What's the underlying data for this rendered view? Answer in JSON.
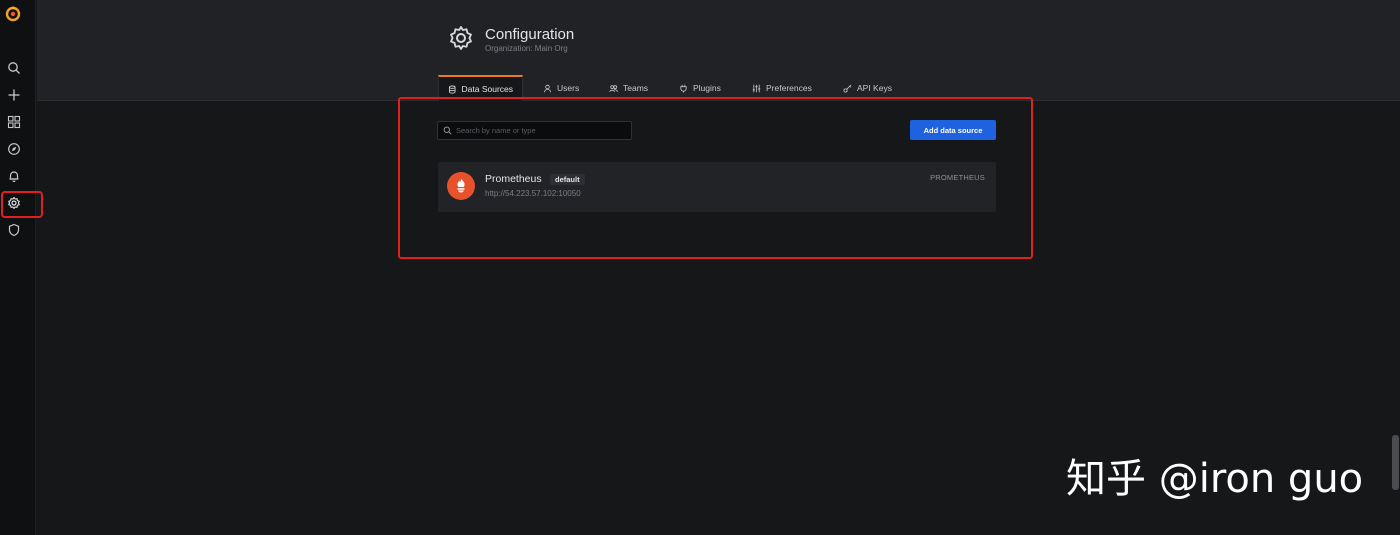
{
  "sidebar": {
    "items": [
      {
        "name": "search-icon"
      },
      {
        "name": "plus-icon"
      },
      {
        "name": "dashboards-icon"
      },
      {
        "name": "explore-icon"
      },
      {
        "name": "alerting-bell-icon"
      },
      {
        "name": "configuration-gear-icon",
        "active": true
      },
      {
        "name": "server-admin-shield-icon"
      }
    ]
  },
  "header": {
    "title": "Configuration",
    "subtitle": "Organization: Main Org"
  },
  "tabs": [
    {
      "label": "Data Sources",
      "icon": "database-icon",
      "active": true
    },
    {
      "label": "Users",
      "icon": "user-icon"
    },
    {
      "label": "Teams",
      "icon": "users-icon"
    },
    {
      "label": "Plugins",
      "icon": "plug-icon"
    },
    {
      "label": "Preferences",
      "icon": "sliders-icon"
    },
    {
      "label": "API Keys",
      "icon": "key-icon"
    }
  ],
  "search": {
    "placeholder": "Search by name or type"
  },
  "add_button": {
    "label": "Add data source"
  },
  "datasources": [
    {
      "name": "Prometheus",
      "badge": "default",
      "url": "http://54.223.57.102:10050",
      "type": "PROMETHEUS",
      "icon": "prometheus-logo-icon"
    }
  ],
  "watermark": "知乎 @iron guo",
  "colors": {
    "accent_tab": "#eb7b18",
    "primary_button": "#1f62e0",
    "highlight_box": "#e02020",
    "prometheus": "#e6522c"
  }
}
